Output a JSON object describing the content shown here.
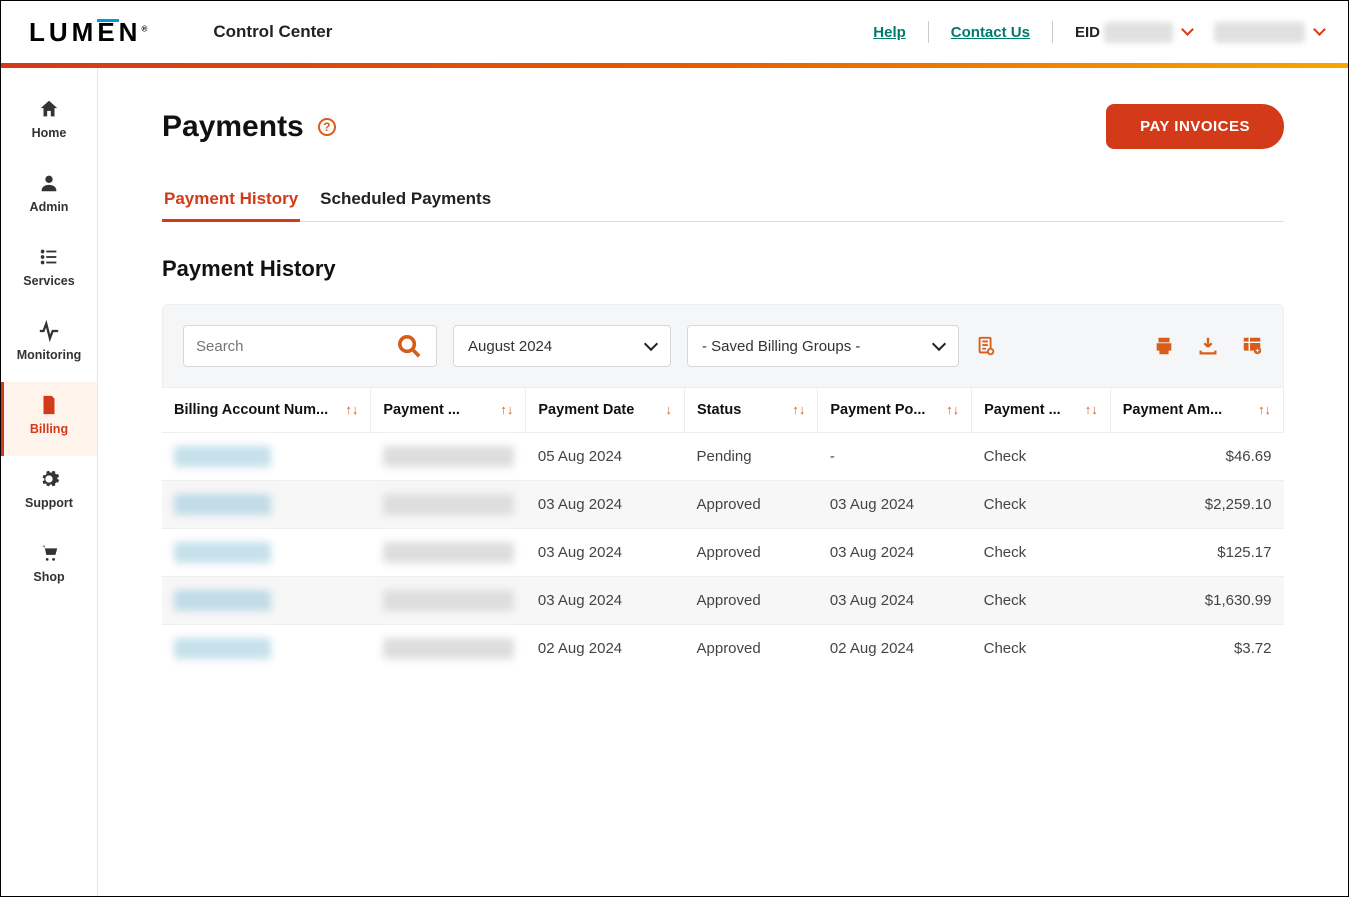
{
  "header": {
    "logo": "LUMEN",
    "app_name": "Control Center",
    "help": "Help",
    "contact": "Contact Us",
    "eid_label": "EID"
  },
  "sidebar": {
    "items": [
      {
        "label": "Home"
      },
      {
        "label": "Admin"
      },
      {
        "label": "Services"
      },
      {
        "label": "Monitoring"
      },
      {
        "label": "Billing"
      },
      {
        "label": "Support"
      },
      {
        "label": "Shop"
      }
    ]
  },
  "page": {
    "title": "Payments",
    "pay_button": "PAY INVOICES",
    "tabs": [
      "Payment History",
      "Scheduled Payments"
    ],
    "sub_heading": "Payment History"
  },
  "toolbar": {
    "search_placeholder": "Search",
    "month": "August 2024",
    "group": "- Saved Billing Groups -"
  },
  "table": {
    "columns": [
      "Billing Account Num...",
      "Payment ...",
      "Payment Date",
      "Status",
      "Payment Po...",
      "Payment ...",
      "Payment Am..."
    ],
    "rows": [
      {
        "date": "05 Aug 2024",
        "status": "Pending",
        "posted": "-",
        "method": "Check",
        "amount": "$46.69"
      },
      {
        "date": "03 Aug 2024",
        "status": "Approved",
        "posted": "03 Aug 2024",
        "method": "Check",
        "amount": "$2,259.10"
      },
      {
        "date": "03 Aug 2024",
        "status": "Approved",
        "posted": "03 Aug 2024",
        "method": "Check",
        "amount": "$125.17"
      },
      {
        "date": "03 Aug 2024",
        "status": "Approved",
        "posted": "03 Aug 2024",
        "method": "Check",
        "amount": "$1,630.99"
      },
      {
        "date": "02 Aug 2024",
        "status": "Approved",
        "posted": "02 Aug 2024",
        "method": "Check",
        "amount": "$3.72"
      }
    ]
  }
}
